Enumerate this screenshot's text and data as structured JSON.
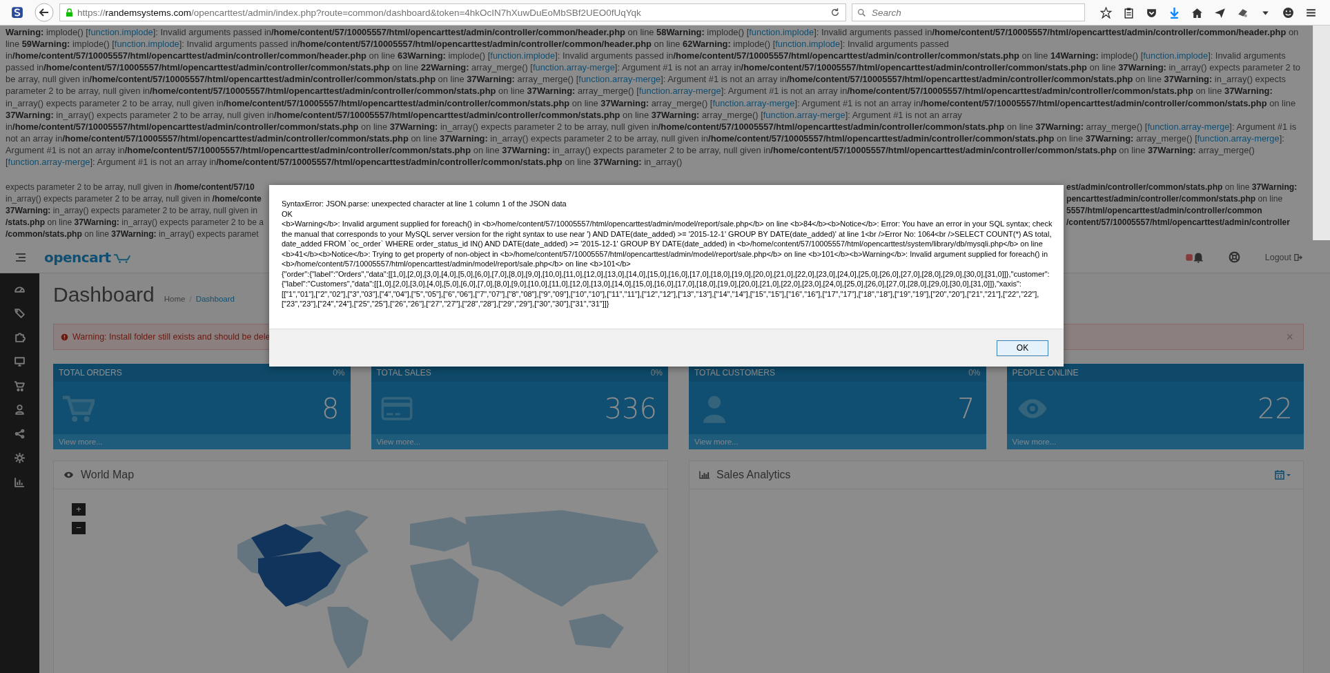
{
  "browser": {
    "url_scheme": "https://",
    "url_host": "randemsystems.com",
    "url_path": "/opencarttest/admin/index.php?route=common/dashboard&token=4hkOcIN7hXuwDuEoMbSBf2UEO0fUqYqk",
    "search_placeholder": "Search"
  },
  "warnings": [
    {
      "label": "Warning:",
      "func": "implode() [",
      "link": "function.implode",
      "message": "]: Invalid arguments passed in",
      "file": "/home/content/57/10005557/html/opencarttest/admin/controller/common/header.php",
      "line_label": "on line",
      "line": "58"
    },
    {
      "label": "Warning:",
      "func": "implode() [",
      "link": "function.implode",
      "message": "]: Invalid arguments passed in",
      "file": "/home/content/57/10005557/html/opencarttest/admin/controller/common/header.php",
      "line_label": "on line",
      "line": "59"
    },
    {
      "label": "Warning:",
      "func": "implode() [",
      "link": "function.implode",
      "message": "]: Invalid arguments passed in",
      "file": "/home/content/57/10005557/html/opencarttest/admin/controller/common/header.php",
      "line_label": "on line",
      "line": "62"
    },
    {
      "label": "Warning:",
      "func": "implode() [",
      "link": "function.implode",
      "message": "]: Invalid arguments passed in",
      "file": "/home/content/57/10005557/html/opencarttest/admin/controller/common/header.php",
      "line_label": "on line",
      "line": "63"
    },
    {
      "label": "Warning:",
      "func": "implode() [",
      "link": "function.implode",
      "message": "]: Invalid arguments passed in",
      "file": "/home/content/57/10005557/html/opencarttest/admin/controller/common/stats.php",
      "line_label": "on line",
      "line": "14"
    },
    {
      "label": "Warning:",
      "func": "implode() [",
      "link": "function.implode",
      "message": "]: Invalid arguments passed in",
      "file": "/home/content/57/10005557/html/opencarttest/admin/controller/common/stats.php",
      "line_label": "on line",
      "line": "22"
    },
    {
      "label": "Warning:",
      "func": "array_merge() [",
      "link": "function.array-merge",
      "message": "]: Argument #1 is not an array in",
      "file": "/home/content/57/10005557/html/opencarttest/admin/controller/common/stats.php",
      "line_label": "on line",
      "line": "37"
    },
    {
      "label": "Warning:",
      "func": "in_array() expects parameter 2 to be array, null given in",
      "file": "/home/content/57/10005557/html/opencarttest/admin/controller/common/stats.php",
      "line_label": "on line",
      "line": "37"
    },
    {
      "label": "Warning:",
      "func": "array_merge() [",
      "link": "function.array-merge",
      "message": "]: Argument #1 is not an array in",
      "file": "/home/content/57/10005557/html/opencarttest/admin/controller/common/stats.php",
      "line_label": "on line",
      "line": "37"
    },
    {
      "label": "Warning:",
      "func": "in_array() expects parameter 2 to be array, null given in",
      "file": "/home/content/57/10005557/html/opencarttest/admin/controller/common/stats.php",
      "line_label": "on line",
      "line": "37"
    },
    {
      "label": "Warning:",
      "func": "array_merge() [",
      "link": "function.array-merge",
      "message": "]: Argument #1 is not an array in",
      "file": "/home/content/57/10005557/html/opencarttest/admin/controller/common/stats.php",
      "line_label": "on line",
      "line": "37"
    },
    {
      "label": "Warning:",
      "func": "in_array() expects parameter 2 to be array, null given in",
      "file": "/home/content/57/10005557/html/opencarttest/admin/controller/common/stats.php",
      "line_label": "on line",
      "line": "37"
    },
    {
      "label": "Warning:",
      "func": "array_merge() [",
      "link": "function.array-merge",
      "message": "]: Argument #1 is not an array in",
      "file": "/home/content/57/10005557/html/opencarttest/admin/controller/common/stats.php",
      "line_label": "on line",
      "line": "37"
    },
    {
      "label": "Warning:",
      "func": "in_array() expects parameter 2 to be array, null given in",
      "file": "/home/content/57/10005557/html/opencarttest/admin/controller/common/stats.php",
      "line_label": "on line",
      "line": "37"
    },
    {
      "label": "Warning:",
      "func": "array_merge() [",
      "link": "function.array-merge",
      "message": "]: Argument #1 is not an array in",
      "file": "/home/content/57/10005557/html/opencarttest/admin/controller/common/stats.php",
      "line_label": "on line",
      "line": "37"
    },
    {
      "label": "Warning:",
      "func": "in_array() expects parameter 2 to be array, null given in",
      "file": "/home/content/57/10005557/html/opencarttest/admin/controller/common/stats.php",
      "line_label": "on line",
      "line": "37"
    },
    {
      "label": "Warning:",
      "func": "array_merge() [",
      "link": "function.array-merge",
      "message": "]: Argument #1 is not an array in",
      "file": "/home/content/57/10005557/html/opencarttest/admin/controller/common/stats.php",
      "line_label": "on line",
      "line": "37"
    },
    {
      "label": "Warning:",
      "func": "in_array() expects parameter 2 to be array, null given in",
      "file": "/home/content/57/10005557/html/opencarttest/admin/controller/common/stats.php",
      "line_label": "on line",
      "line": "37"
    },
    {
      "label": "Warning:",
      "func": "array_merge() [",
      "link": "function.array-merge",
      "message": "]: Argument #1 is not an array in",
      "file": "/home/content/57/10005557/html/opencarttest/admin/controller/common/stats.php",
      "line_label": "on line",
      "line": "37"
    },
    {
      "label": "Warning:",
      "func": "in_array() expects parameter 2 to be array, null given in",
      "file": "/home/content/57/10005557/html/opencarttest/admin/controller/common/stats.php",
      "line_label": "on line",
      "line": "37"
    },
    {
      "label": "Warning:",
      "func": "array_merge() [",
      "link": "function.array-merge",
      "message": "]: Argument #1 is not an array in",
      "file": "/home/content/57/10005557/html/opencarttest/admin/controller/common/stats.php",
      "line_label": "on line",
      "line": "37"
    },
    {
      "label": "Warning:",
      "func": "in_array()"
    }
  ],
  "warning_fragments_left": [
    "expects parameter 2 to be array, null given in **/home/content/57/10**",
    "in_array() expects parameter 2 to be array, null given in **/home/conte**",
    "**37Warning:** in_array() expects parameter 2 to be array, null given in",
    "**/stats.php** on line **37Warning:** in_array() expects parameter 2 to be a",
    "**/common/stats.php** on line **37Warning:** in_array() expects paramet"
  ],
  "warning_fragments_right": [
    "**est/admin/controller/common/stats.php** on line **37Warning:**",
    "**pencarttest/admin/controller/common/stats.php** on line",
    "**5557/html/opencarttest/admin/controller/common**",
    "**/content/57/10005557/html/opencarttest/admin/controller**"
  ],
  "header": {
    "logo": "opencart",
    "logout": "Logout"
  },
  "page": {
    "title": "Dashboard",
    "breadcrumb": [
      "Home",
      "Dashboard"
    ],
    "breadcrumb_separator": "/",
    "alert": "Warning: Install folder still exists and should be dele",
    "alert_close": "×"
  },
  "tiles": [
    {
      "kind": "orders",
      "title": "TOTAL ORDERS",
      "percent": "0%",
      "value": "8",
      "link": "View more..."
    },
    {
      "kind": "sales",
      "title": "TOTAL SALES",
      "percent": "0%",
      "value": "336",
      "link": "View more..."
    },
    {
      "kind": "customers",
      "title": "TOTAL CUSTOMERS",
      "percent": "0%",
      "value": "7",
      "link": "View more..."
    },
    {
      "kind": "online",
      "title": "PEOPLE ONLINE",
      "value": "22",
      "link": "View more..."
    }
  ],
  "panels": [
    {
      "kind": "map",
      "title": "World Map",
      "zoom_in": "+",
      "zoom_out": "−"
    },
    {
      "kind": "chart",
      "title": "Sales Analytics"
    }
  ],
  "dialog": {
    "lines": [
      "SyntaxError: JSON.parse: unexpected character at line 1 column 1 of the JSON data",
      "OK",
      "<b>Warning</b>: Invalid argument supplied for foreach() in <b>/home/content/57/10005557/html/opencarttest/admin/model/report/sale.php</b> on line <b>84</b><b>Notice</b>: Error: You have an error in your SQL syntax; check the manual that corresponds to your MySQL server version for the right syntax to use near ') AND DATE(date_added) >= '2015-12-1' GROUP BY DATE(date_added)' at line 1<br />Error No: 1064<br />SELECT COUNT(*) AS total, date_added FROM `oc_order` WHERE order_status_id IN() AND DATE(date_added) >= '2015-12-1' GROUP BY DATE(date_added) in <b>/home/content/57/10005557/html/opencarttest/system/library/db/mysqli.php</b> on line <b>41</b><b>Notice</b>: Trying to get property of non-object in <b>/home/content/57/10005557/html/opencarttest/admin/model/report/sale.php</b> on line <b>101</b><b>Warning</b>: Invalid argument supplied for foreach() in <b>/home/content/57/10005557/html/opencarttest/admin/model/report/sale.php</b> on line <b>101</b>",
      "{\"order\":{\"label\":\"Orders\",\"data\":[[1,0],[2,0],[3,0],[4,0],[5,0],[6,0],[7,0],[8,0],[9,0],[10,0],[11,0],[12,0],[13,0],[14,0],[15,0],[16,0],[17,0],[18,0],[19,0],[20,0],[21,0],[22,0],[23,0],[24,0],[25,0],[26,0],[27,0],[28,0],[29,0],[30,0],[31,0]]},\"customer\":{\"label\":\"Customers\",\"data\":[[1,0],[2,0],[3,0],[4,0],[5,0],[6,0],[7,0],[8,0],[9,0],[10,0],[11,0],[12,0],[13,0],[14,0],[15,0],[16,0],[17,0],[18,0],[19,0],[20,0],[21,0],[22,0],[23,0],[24,0],[25,0],[26,0],[27,0],[28,0],[29,0],[30,0],[31,0]]},\"xaxis\":[[\"1\",\"01\"],[\"2\",\"02\"],[\"3\",\"03\"],[\"4\",\"04\"],[\"5\",\"05\"],[\"6\",\"06\"],[\"7\",\"07\"],[\"8\",\"08\"],[\"9\",\"09\"],[\"10\",\"10\"],[\"11\",\"11\"],[\"12\",\"12\"],[\"13\",\"13\"],[\"14\",\"14\"],[\"15\",\"15\"],[\"16\",\"16\"],[\"17\",\"17\"],[\"18\",\"18\"],[\"19\",\"19\"],[\"20\",\"20\"],[\"21\",\"21\"],[\"22\",\"22\"],[\"23\",\"23\"],[\"24\",\"24\"],[\"25\",\"25\"],[\"26\",\"26\"],[\"27\",\"27\"],[\"28\",\"28\"],[\"29\",\"29\"],[\"30\",\"30\"],[\"31\",\"31\"]]}"
    ],
    "button": "OK"
  }
}
